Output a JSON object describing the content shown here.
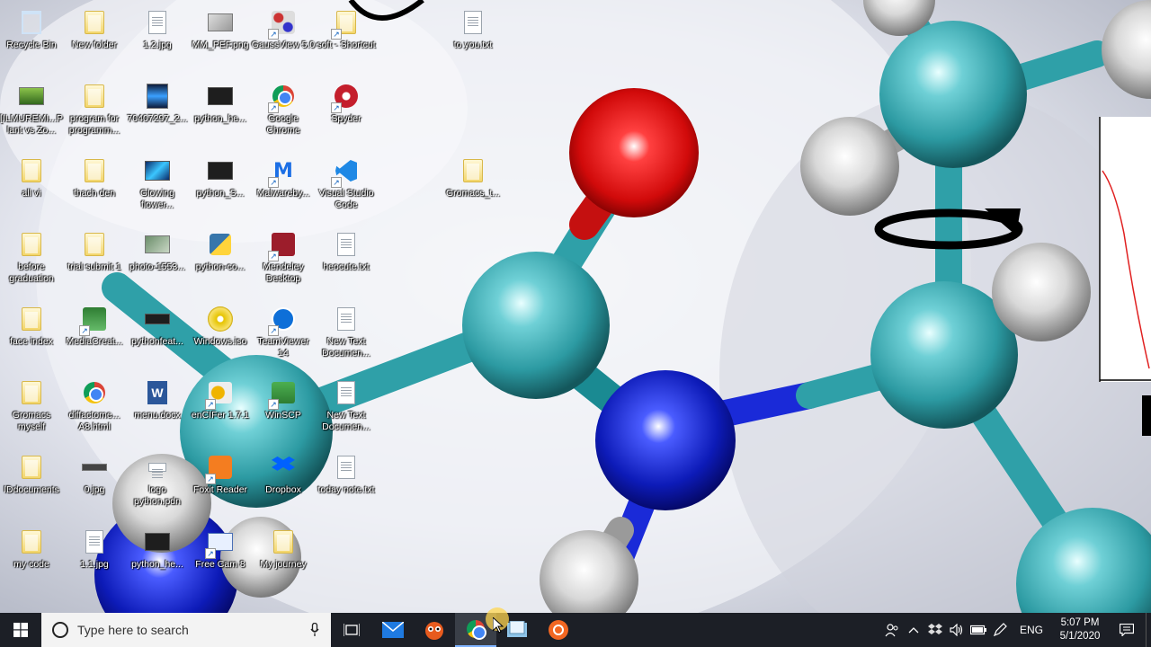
{
  "desktop": {
    "icons": [
      {
        "label": "Recycle Bin",
        "icon": "recycle-bin-icon"
      },
      {
        "label": "New folder",
        "icon": "folder-icon"
      },
      {
        "label": "1.2.jpg",
        "icon": "image-file-icon"
      },
      {
        "label": "MM_PEF.png",
        "icon": "image-file-icon"
      },
      {
        "label": "GaussView 5.0",
        "icon": "gaussview-icon"
      },
      {
        "label": "soft - Shortcut",
        "icon": "folder-shortcut-icon"
      },
      {
        "label": "to you.txt",
        "icon": "text-file-icon"
      },
      {
        "label": "[ILMUREMI...Plant vs Zo...",
        "icon": "game-icon"
      },
      {
        "label": "program for programm...",
        "icon": "folder-icon"
      },
      {
        "label": "70407297_2...",
        "icon": "image-file-icon"
      },
      {
        "label": "python_he...",
        "icon": "terminal-file-icon"
      },
      {
        "label": "Google Chrome",
        "icon": "chrome-icon"
      },
      {
        "label": "Spyder",
        "icon": "spyder-icon"
      },
      {
        "label": "all vi",
        "icon": "folder-icon"
      },
      {
        "label": "thach den",
        "icon": "folder-icon"
      },
      {
        "label": "Glowing flower...",
        "icon": "image-file-icon"
      },
      {
        "label": "python_S...",
        "icon": "terminal-file-icon"
      },
      {
        "label": "Malwareby...",
        "icon": "malwarebytes-icon"
      },
      {
        "label": "Visual Studio Code",
        "icon": "vscode-icon"
      },
      {
        "label": "Gromacs_t...",
        "icon": "folder-icon"
      },
      {
        "label": "before graduation",
        "icon": "folder-icon"
      },
      {
        "label": "trial submit 1",
        "icon": "folder-icon"
      },
      {
        "label": "photo-1553...",
        "icon": "image-file-icon"
      },
      {
        "label": "python-co...",
        "icon": "python-icon"
      },
      {
        "label": "Mendeley Desktop",
        "icon": "mendeley-icon"
      },
      {
        "label": "heocute.txt",
        "icon": "text-file-icon"
      },
      {
        "label": "face index",
        "icon": "folder-icon"
      },
      {
        "label": "MediaCreat...",
        "icon": "media-creation-icon"
      },
      {
        "label": "pythonfeat...",
        "icon": "terminal-file-icon"
      },
      {
        "label": "Windows.iso",
        "icon": "disc-image-icon"
      },
      {
        "label": "TeamViewer 14",
        "icon": "teamviewer-icon"
      },
      {
        "label": "New Text Documen...",
        "icon": "text-file-icon"
      },
      {
        "label": "Gromacs myself",
        "icon": "folder-icon"
      },
      {
        "label": "diffactome... A8.html",
        "icon": "chrome-icon"
      },
      {
        "label": "menu.docx",
        "icon": "word-doc-icon"
      },
      {
        "label": "enCIFer 1.7.1",
        "icon": "encifer-icon"
      },
      {
        "label": "WinSCP",
        "icon": "winscp-icon"
      },
      {
        "label": "New Text Documen...",
        "icon": "text-file-icon"
      },
      {
        "label": "IDdocuments",
        "icon": "folder-icon"
      },
      {
        "label": "0.jpg",
        "icon": "image-file-icon"
      },
      {
        "label": "logo python.pdn",
        "icon": "image-file-icon"
      },
      {
        "label": "Foxit Reader",
        "icon": "foxit-icon"
      },
      {
        "label": "Dropbox",
        "icon": "dropbox-icon"
      },
      {
        "label": "today note.txt",
        "icon": "text-file-icon"
      },
      {
        "label": "my code",
        "icon": "folder-icon"
      },
      {
        "label": "1.1.jpg",
        "icon": "image-file-icon"
      },
      {
        "label": "python_he...",
        "icon": "terminal-file-icon"
      },
      {
        "label": "Free Cam 8",
        "icon": "freecam-icon"
      },
      {
        "label": "My journey",
        "icon": "folder-icon"
      }
    ]
  },
  "taskbar": {
    "search_placeholder": "Type here to search",
    "pinned": [
      {
        "name": "task-view",
        "icon": "task-view-icon"
      },
      {
        "name": "mail",
        "icon": "mail-icon"
      },
      {
        "name": "game-app",
        "icon": "game-app-icon"
      },
      {
        "name": "google-chrome",
        "icon": "chrome-icon"
      },
      {
        "name": "file-app",
        "icon": "file-app-icon"
      },
      {
        "name": "record-app",
        "icon": "record-app-icon"
      }
    ],
    "tray": {
      "language": "ENG",
      "time": "5:07 PM",
      "date": "5/1/2020"
    }
  },
  "colors": {
    "taskbar_bg": "#1c1f26",
    "carbon": "#2fa0a8",
    "nitrogen": "#1a2ad8",
    "oxygen": "#e01010",
    "hydrogen": "#e8e8e8"
  }
}
